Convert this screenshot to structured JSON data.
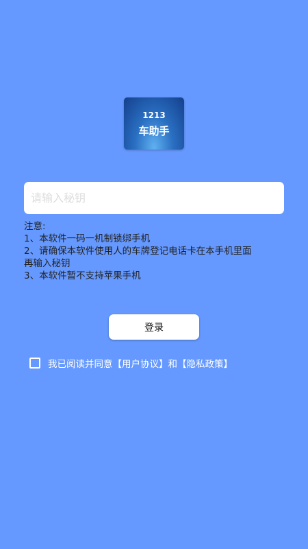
{
  "logo": {
    "number": "1213",
    "name": "车助手"
  },
  "key_input": {
    "value": "",
    "placeholder": "请输入秘钥"
  },
  "notice": {
    "title": "注意:",
    "items": [
      "1、本软件一码一机制锁绑手机",
      "2、请确保本软件使用人的车牌登记电话卡在本手机里面",
      "再输入秘钥",
      "3、本软件暂不支持苹果手机"
    ]
  },
  "login_button": {
    "label": "登录"
  },
  "agreement": {
    "checked": false,
    "text": "我已阅读并同意【用户协议】和【隐私政策】"
  },
  "colors": {
    "background": "#6699ff",
    "button_background": "#ffffff",
    "logo_gradient_center": "#5fb0f0",
    "logo_gradient_edge": "#143f8c"
  }
}
